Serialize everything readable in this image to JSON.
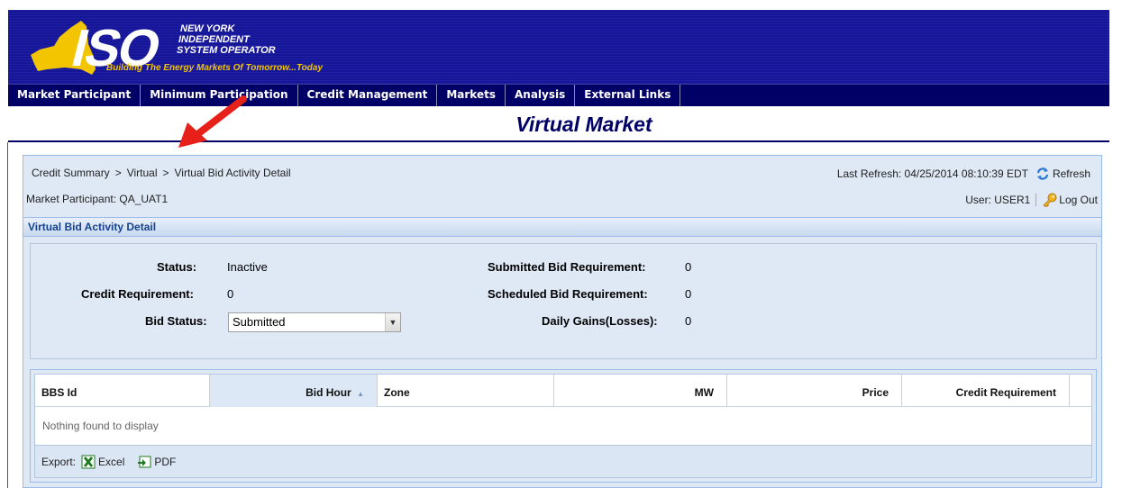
{
  "header": {
    "logo_text": "ISO",
    "org_line1": "NEW YORK",
    "org_line2": "INDEPENDENT",
    "org_line3": "SYSTEM OPERATOR",
    "tagline": "Building The Energy Markets Of Tomorrow...Today"
  },
  "nav": {
    "items": [
      "Market Participant",
      "Minimum Participation",
      "Credit Management",
      "Markets",
      "Analysis",
      "External Links"
    ]
  },
  "page_title": "Virtual Market",
  "breadcrumb": [
    "Credit Summary",
    "Virtual",
    "Virtual Bid Activity Detail"
  ],
  "breadcrumb_sep": ">",
  "market_participant": "Market Participant: QA_UAT1",
  "last_refresh": "Last Refresh: 04/25/2014 08:10:39 EDT",
  "refresh_label": "Refresh",
  "user_label": "User: USER1",
  "logout_label": "Log Out",
  "section_title": "Virtual Bid Activity Detail",
  "form": {
    "status_label": "Status:",
    "status_value": "Inactive",
    "credit_req_label": "Credit Requirement:",
    "credit_req_value": "0",
    "bid_status_label": "Bid Status:",
    "bid_status_value": "Submitted",
    "submitted_bid_label": "Submitted Bid Requirement:",
    "submitted_bid_value": "0",
    "scheduled_bid_label": "Scheduled Bid Requirement:",
    "scheduled_bid_value": "0",
    "daily_gains_label": "Daily Gains(Losses):",
    "daily_gains_value": "0"
  },
  "table": {
    "columns": [
      "BBS Id",
      "Bid Hour",
      "Zone",
      "MW",
      "Price",
      "Credit Requirement"
    ],
    "sort_indicator": "▲",
    "empty_message": "Nothing found to display"
  },
  "export": {
    "label": "Export:",
    "excel": "Excel",
    "pdf": "PDF"
  },
  "colors": {
    "banner": "#15159a",
    "nav": "#000066",
    "title": "#000066",
    "panel": "#dfe8f5",
    "section_text": "#15428b",
    "annotation_arrow": "#e8201a"
  }
}
